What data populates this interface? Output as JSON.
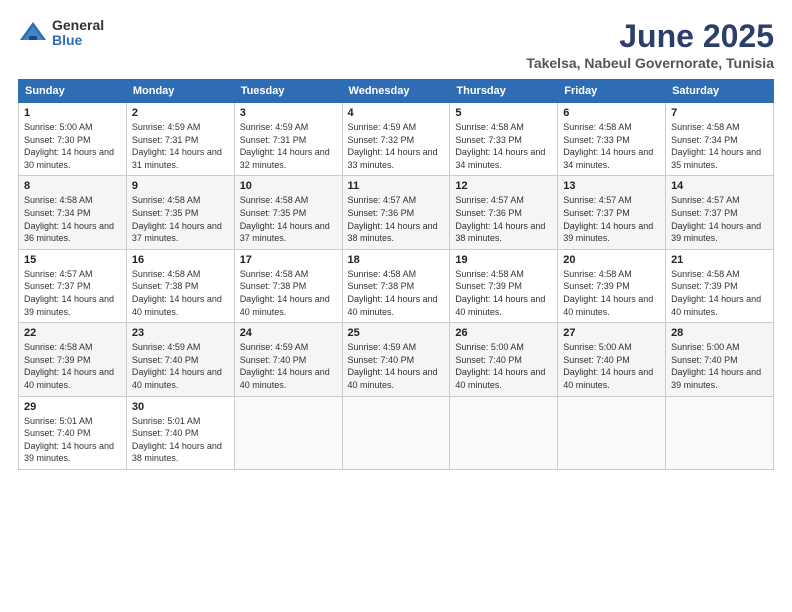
{
  "logo": {
    "general": "General",
    "blue": "Blue"
  },
  "title": "June 2025",
  "location": "Takelsa, Nabeul Governorate, Tunisia",
  "headers": [
    "Sunday",
    "Monday",
    "Tuesday",
    "Wednesday",
    "Thursday",
    "Friday",
    "Saturday"
  ],
  "weeks": [
    [
      {
        "day": "1",
        "rise": "Sunrise: 5:00 AM",
        "set": "Sunset: 7:30 PM",
        "daylight": "Daylight: 14 hours and 30 minutes."
      },
      {
        "day": "2",
        "rise": "Sunrise: 4:59 AM",
        "set": "Sunset: 7:31 PM",
        "daylight": "Daylight: 14 hours and 31 minutes."
      },
      {
        "day": "3",
        "rise": "Sunrise: 4:59 AM",
        "set": "Sunset: 7:31 PM",
        "daylight": "Daylight: 14 hours and 32 minutes."
      },
      {
        "day": "4",
        "rise": "Sunrise: 4:59 AM",
        "set": "Sunset: 7:32 PM",
        "daylight": "Daylight: 14 hours and 33 minutes."
      },
      {
        "day": "5",
        "rise": "Sunrise: 4:58 AM",
        "set": "Sunset: 7:33 PM",
        "daylight": "Daylight: 14 hours and 34 minutes."
      },
      {
        "day": "6",
        "rise": "Sunrise: 4:58 AM",
        "set": "Sunset: 7:33 PM",
        "daylight": "Daylight: 14 hours and 34 minutes."
      },
      {
        "day": "7",
        "rise": "Sunrise: 4:58 AM",
        "set": "Sunset: 7:34 PM",
        "daylight": "Daylight: 14 hours and 35 minutes."
      }
    ],
    [
      {
        "day": "8",
        "rise": "Sunrise: 4:58 AM",
        "set": "Sunset: 7:34 PM",
        "daylight": "Daylight: 14 hours and 36 minutes."
      },
      {
        "day": "9",
        "rise": "Sunrise: 4:58 AM",
        "set": "Sunset: 7:35 PM",
        "daylight": "Daylight: 14 hours and 37 minutes."
      },
      {
        "day": "10",
        "rise": "Sunrise: 4:58 AM",
        "set": "Sunset: 7:35 PM",
        "daylight": "Daylight: 14 hours and 37 minutes."
      },
      {
        "day": "11",
        "rise": "Sunrise: 4:57 AM",
        "set": "Sunset: 7:36 PM",
        "daylight": "Daylight: 14 hours and 38 minutes."
      },
      {
        "day": "12",
        "rise": "Sunrise: 4:57 AM",
        "set": "Sunset: 7:36 PM",
        "daylight": "Daylight: 14 hours and 38 minutes."
      },
      {
        "day": "13",
        "rise": "Sunrise: 4:57 AM",
        "set": "Sunset: 7:37 PM",
        "daylight": "Daylight: 14 hours and 39 minutes."
      },
      {
        "day": "14",
        "rise": "Sunrise: 4:57 AM",
        "set": "Sunset: 7:37 PM",
        "daylight": "Daylight: 14 hours and 39 minutes."
      }
    ],
    [
      {
        "day": "15",
        "rise": "Sunrise: 4:57 AM",
        "set": "Sunset: 7:37 PM",
        "daylight": "Daylight: 14 hours and 39 minutes."
      },
      {
        "day": "16",
        "rise": "Sunrise: 4:58 AM",
        "set": "Sunset: 7:38 PM",
        "daylight": "Daylight: 14 hours and 40 minutes."
      },
      {
        "day": "17",
        "rise": "Sunrise: 4:58 AM",
        "set": "Sunset: 7:38 PM",
        "daylight": "Daylight: 14 hours and 40 minutes."
      },
      {
        "day": "18",
        "rise": "Sunrise: 4:58 AM",
        "set": "Sunset: 7:38 PM",
        "daylight": "Daylight: 14 hours and 40 minutes."
      },
      {
        "day": "19",
        "rise": "Sunrise: 4:58 AM",
        "set": "Sunset: 7:39 PM",
        "daylight": "Daylight: 14 hours and 40 minutes."
      },
      {
        "day": "20",
        "rise": "Sunrise: 4:58 AM",
        "set": "Sunset: 7:39 PM",
        "daylight": "Daylight: 14 hours and 40 minutes."
      },
      {
        "day": "21",
        "rise": "Sunrise: 4:58 AM",
        "set": "Sunset: 7:39 PM",
        "daylight": "Daylight: 14 hours and 40 minutes."
      }
    ],
    [
      {
        "day": "22",
        "rise": "Sunrise: 4:58 AM",
        "set": "Sunset: 7:39 PM",
        "daylight": "Daylight: 14 hours and 40 minutes."
      },
      {
        "day": "23",
        "rise": "Sunrise: 4:59 AM",
        "set": "Sunset: 7:40 PM",
        "daylight": "Daylight: 14 hours and 40 minutes."
      },
      {
        "day": "24",
        "rise": "Sunrise: 4:59 AM",
        "set": "Sunset: 7:40 PM",
        "daylight": "Daylight: 14 hours and 40 minutes."
      },
      {
        "day": "25",
        "rise": "Sunrise: 4:59 AM",
        "set": "Sunset: 7:40 PM",
        "daylight": "Daylight: 14 hours and 40 minutes."
      },
      {
        "day": "26",
        "rise": "Sunrise: 5:00 AM",
        "set": "Sunset: 7:40 PM",
        "daylight": "Daylight: 14 hours and 40 minutes."
      },
      {
        "day": "27",
        "rise": "Sunrise: 5:00 AM",
        "set": "Sunset: 7:40 PM",
        "daylight": "Daylight: 14 hours and 40 minutes."
      },
      {
        "day": "28",
        "rise": "Sunrise: 5:00 AM",
        "set": "Sunset: 7:40 PM",
        "daylight": "Daylight: 14 hours and 39 minutes."
      }
    ],
    [
      {
        "day": "29",
        "rise": "Sunrise: 5:01 AM",
        "set": "Sunset: 7:40 PM",
        "daylight": "Daylight: 14 hours and 39 minutes."
      },
      {
        "day": "30",
        "rise": "Sunrise: 5:01 AM",
        "set": "Sunset: 7:40 PM",
        "daylight": "Daylight: 14 hours and 38 minutes."
      },
      null,
      null,
      null,
      null,
      null
    ]
  ]
}
